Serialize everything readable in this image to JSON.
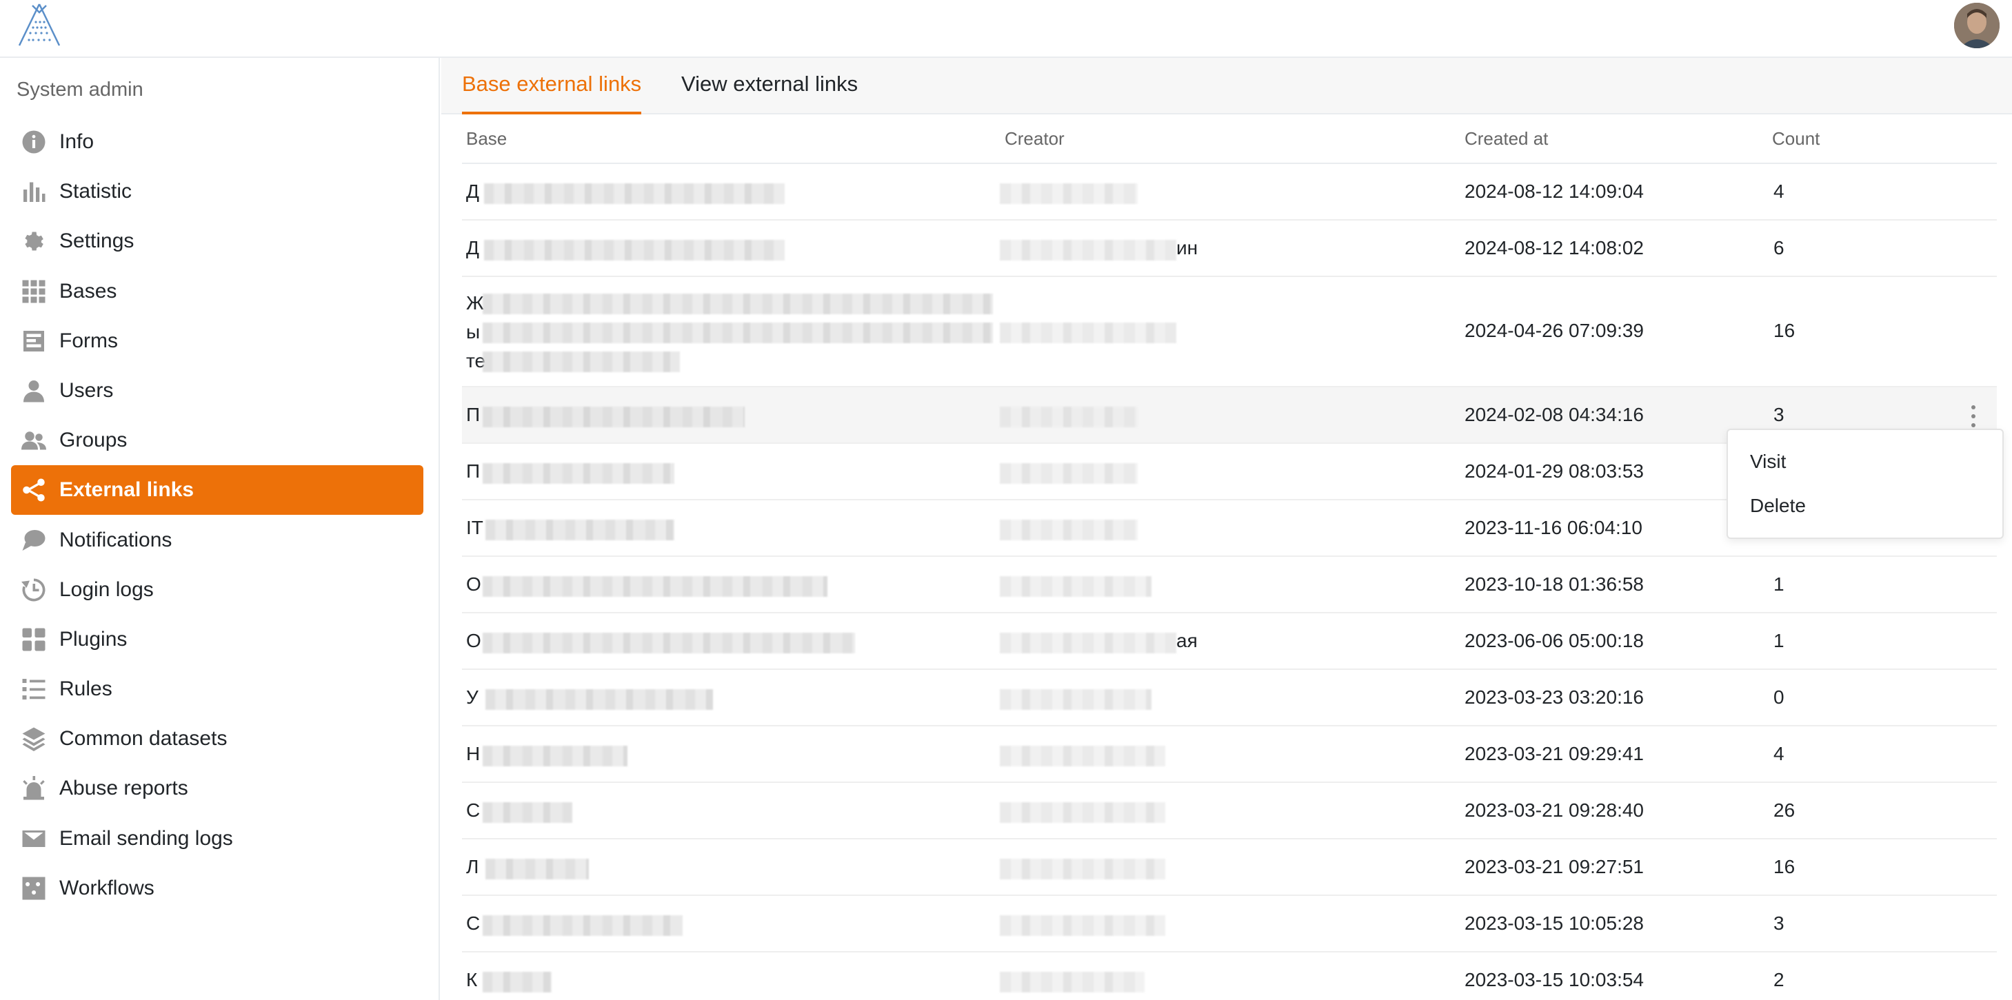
{
  "colors": {
    "accent": "#ed7109",
    "muted": "#999999"
  },
  "sidebar": {
    "title": "System admin",
    "items": [
      {
        "label": "Info",
        "icon": "info-icon",
        "active": false
      },
      {
        "label": "Statistic",
        "icon": "statistic-icon",
        "active": false
      },
      {
        "label": "Settings",
        "icon": "gear-icon",
        "active": false
      },
      {
        "label": "Bases",
        "icon": "grid-icon",
        "active": false
      },
      {
        "label": "Forms",
        "icon": "form-icon",
        "active": false
      },
      {
        "label": "Users",
        "icon": "user-icon",
        "active": false
      },
      {
        "label": "Groups",
        "icon": "group-icon",
        "active": false
      },
      {
        "label": "External links",
        "icon": "share-icon",
        "active": true
      },
      {
        "label": "Notifications",
        "icon": "chat-icon",
        "active": false
      },
      {
        "label": "Login logs",
        "icon": "history-icon",
        "active": false
      },
      {
        "label": "Plugins",
        "icon": "plugin-icon",
        "active": false
      },
      {
        "label": "Rules",
        "icon": "rules-icon",
        "active": false
      },
      {
        "label": "Common datasets",
        "icon": "layers-icon",
        "active": false
      },
      {
        "label": "Abuse reports",
        "icon": "alarm-icon",
        "active": false
      },
      {
        "label": "Email sending logs",
        "icon": "mail-icon",
        "active": false
      },
      {
        "label": "Workflows",
        "icon": "workflow-icon",
        "active": false
      }
    ]
  },
  "tabs": [
    {
      "label": "Base external links",
      "active": true
    },
    {
      "label": "View external links",
      "active": false
    }
  ],
  "table": {
    "columns": [
      "Base",
      "Creator",
      "Created at",
      "Count"
    ],
    "rows": [
      {
        "base": "Д",
        "creator": "",
        "created_at": "2024-08-12 14:09:04",
        "count": "4"
      },
      {
        "base": "Д",
        "creator": "ин",
        "created_at": "2024-08-12 14:08:02",
        "count": "6"
      },
      {
        "base": "Ж",
        "base2": "ы",
        "base3": "те",
        "creator": "",
        "created_at": "2024-04-26 07:09:39",
        "count": "16"
      },
      {
        "base": "П",
        "creator": "",
        "created_at": "2024-02-08 04:34:16",
        "count": "3"
      },
      {
        "base": "П",
        "creator": "",
        "created_at": "2024-01-29 08:03:53",
        "count": ""
      },
      {
        "base": "IT",
        "creator": "",
        "created_at": "2023-11-16 06:04:10",
        "count": ""
      },
      {
        "base": "О",
        "creator": "",
        "created_at": "2023-10-18 01:36:58",
        "count": "1"
      },
      {
        "base": "О",
        "creator": "ая",
        "created_at": "2023-06-06 05:00:18",
        "count": "1"
      },
      {
        "base": "У",
        "creator": "",
        "created_at": "2023-03-23 03:20:16",
        "count": "0"
      },
      {
        "base": "Н",
        "creator": "",
        "created_at": "2023-03-21 09:29:41",
        "count": "4"
      },
      {
        "base": "С",
        "creator": "",
        "created_at": "2023-03-21 09:28:40",
        "count": "26"
      },
      {
        "base": "Л",
        "creator": "",
        "created_at": "2023-03-21 09:27:51",
        "count": "16"
      },
      {
        "base": "С",
        "creator": "",
        "created_at": "2023-03-15 10:05:28",
        "count": "3"
      },
      {
        "base": "К",
        "creator": "",
        "created_at": "2023-03-15 10:03:54",
        "count": "2"
      }
    ]
  },
  "context_menu": {
    "items": [
      "Visit",
      "Delete"
    ]
  }
}
